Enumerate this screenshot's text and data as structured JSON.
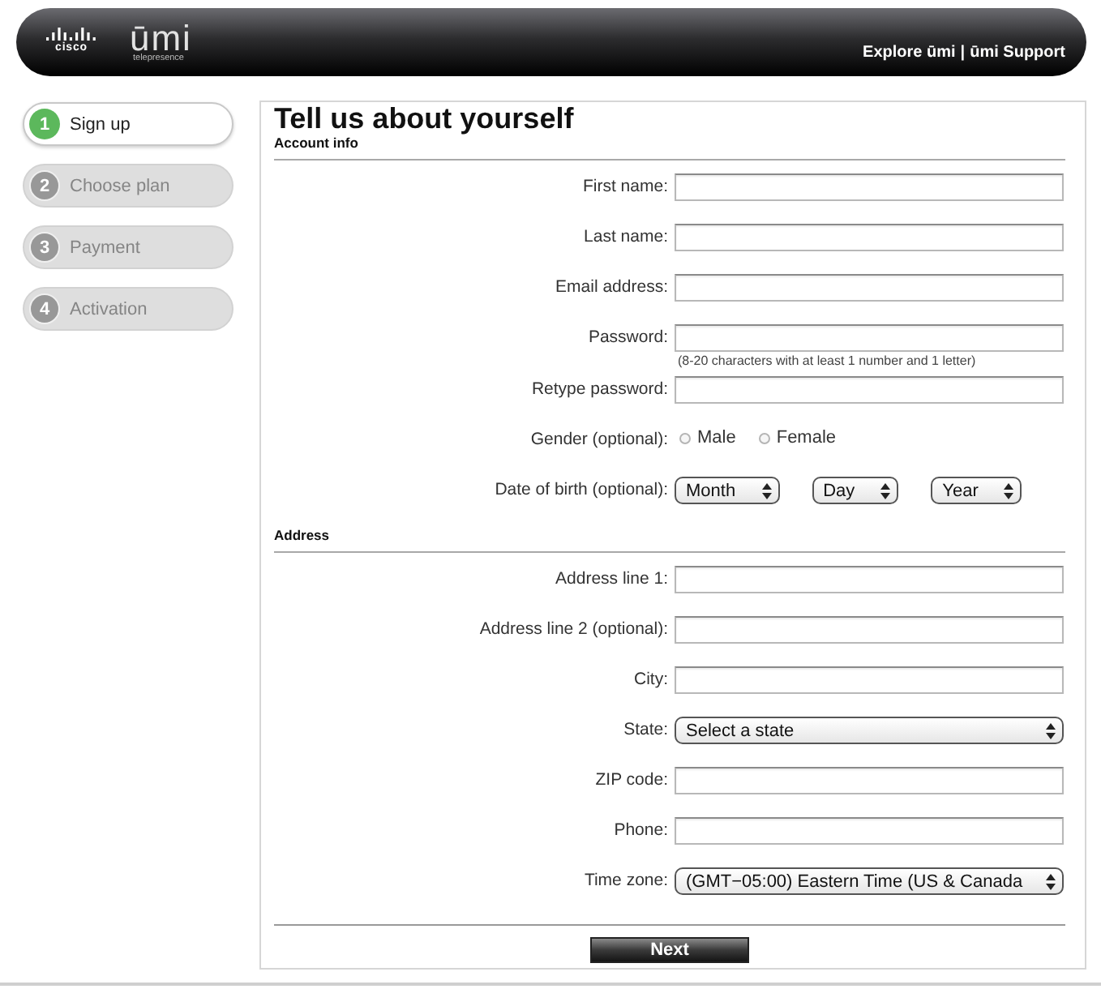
{
  "header": {
    "logo": {
      "company": "cisco",
      "product": "ūmi",
      "tagline": "telepresence"
    },
    "links": [
      {
        "label": "Explore ūmi"
      },
      {
        "label": "ūmi Support"
      }
    ],
    "link_separator": "|"
  },
  "steps": [
    {
      "number": "1",
      "label": "Sign up",
      "selected": true
    },
    {
      "number": "2",
      "label": "Choose plan",
      "selected": false
    },
    {
      "number": "3",
      "label": "Payment",
      "selected": false
    },
    {
      "number": "4",
      "label": "Activation",
      "selected": false
    }
  ],
  "form": {
    "title": "Tell us about yourself",
    "sections": [
      {
        "heading": "Account info",
        "fields": [
          {
            "kind": "text",
            "label": "First name:"
          },
          {
            "kind": "text",
            "label": "Last name:"
          },
          {
            "kind": "text",
            "label": "Email address:"
          },
          {
            "kind": "text",
            "label": "Password:",
            "hint": "(8-20 characters with at least 1 number and 1 letter)"
          },
          {
            "kind": "text",
            "label": "Retype password:"
          },
          {
            "kind": "radio",
            "label": "Gender (optional):",
            "options": [
              {
                "label": "Male",
                "selected": false
              },
              {
                "label": "Female",
                "selected": false
              }
            ]
          },
          {
            "kind": "select_group",
            "label": "Date of birth (optional):",
            "selects": [
              {
                "value": "Month"
              },
              {
                "value": "Day"
              },
              {
                "value": "Year"
              }
            ]
          }
        ]
      },
      {
        "heading": "Address",
        "fields": [
          {
            "kind": "text",
            "label": "Address line 1:"
          },
          {
            "kind": "text",
            "label": "Address line 2 (optional):"
          },
          {
            "kind": "text",
            "label": "City:"
          },
          {
            "kind": "select",
            "label": "State:",
            "value": "Select a state"
          },
          {
            "kind": "text",
            "label": "ZIP code:"
          },
          {
            "kind": "text",
            "label": "Phone:"
          },
          {
            "kind": "select",
            "label": "Time zone:",
            "value": "(GMT−05:00) Eastern Time (US & Canada"
          }
        ]
      }
    ],
    "submit": {
      "label": "Next"
    }
  }
}
